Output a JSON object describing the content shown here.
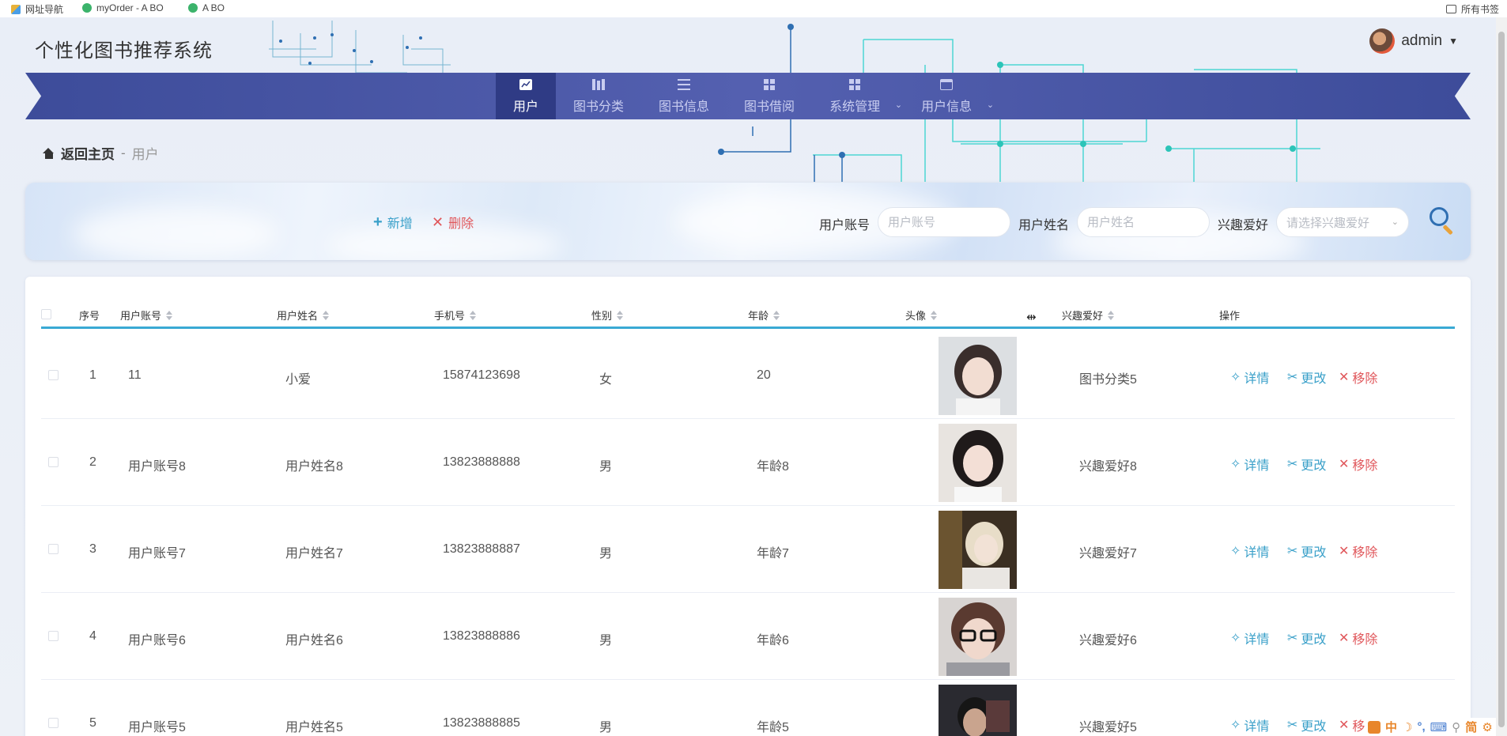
{
  "bookmarks": {
    "items": [
      {
        "label": "网址导航"
      },
      {
        "label": "myOrder - A BO"
      },
      {
        "label": "A BO"
      }
    ],
    "right_label": "所有书签"
  },
  "header": {
    "site_title": "个性化图书推荐系统",
    "user_name": "admin"
  },
  "nav": {
    "items": [
      {
        "label": "用户",
        "icon": "chart-icon"
      },
      {
        "label": "图书分类",
        "icon": "books-icon"
      },
      {
        "label": "图书信息",
        "icon": "list-icon"
      },
      {
        "label": "图书借阅",
        "icon": "grid-icon"
      },
      {
        "label": "系统管理",
        "icon": "grid-icon"
      },
      {
        "label": "用户信息",
        "icon": "card-icon"
      }
    ]
  },
  "breadcrumb": {
    "home": "返回主页",
    "separator": "-",
    "current": "用户"
  },
  "search": {
    "add_label": "新增",
    "delete_label": "删除",
    "account_label": "用户账号",
    "account_placeholder": "用户账号",
    "name_label": "用户姓名",
    "name_placeholder": "用户姓名",
    "hobby_label": "兴趣爱好",
    "hobby_placeholder": "请选择兴趣爱好"
  },
  "table": {
    "columns": {
      "index": "序号",
      "account": "用户账号",
      "name": "用户姓名",
      "phone": "手机号",
      "gender": "性别",
      "age": "年龄",
      "avatar": "头像",
      "hobby": "兴趣爱好",
      "actions": "操作"
    },
    "actions": {
      "detail": "详情",
      "edit": "更改",
      "remove": "移除"
    },
    "rows": [
      {
        "index": "1",
        "account": "11",
        "name": "小爱",
        "phone": "15874123698",
        "gender": "女",
        "age": "20",
        "hobby": "图书分类5"
      },
      {
        "index": "2",
        "account": "用户账号8",
        "name": "用户姓名8",
        "phone": "13823888888",
        "gender": "男",
        "age": "年龄8",
        "hobby": "兴趣爱好8"
      },
      {
        "index": "3",
        "account": "用户账号7",
        "name": "用户姓名7",
        "phone": "13823888887",
        "gender": "男",
        "age": "年龄7",
        "hobby": "兴趣爱好7"
      },
      {
        "index": "4",
        "account": "用户账号6",
        "name": "用户姓名6",
        "phone": "13823888886",
        "gender": "男",
        "age": "年龄6",
        "hobby": "兴趣爱好6"
      },
      {
        "index": "5",
        "account": "用户账号5",
        "name": "用户姓名5",
        "phone": "13823888885",
        "gender": "男",
        "age": "年龄5",
        "hobby": "兴趣爱好5"
      }
    ]
  },
  "ime": {
    "lang": "中",
    "mode": "简"
  },
  "colors": {
    "nav_bg": "#4450a2",
    "nav_active": "#2f3b85",
    "accent_blue": "#3aa0c9",
    "danger_red": "#e0575b",
    "table_header_line": "#3aa9d4"
  }
}
